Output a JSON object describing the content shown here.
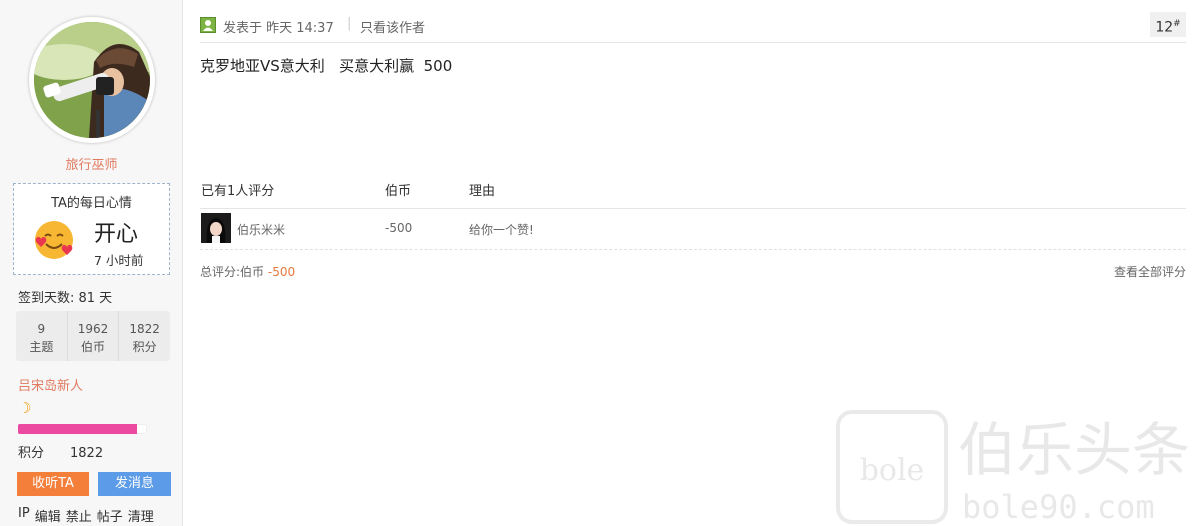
{
  "sidebar": {
    "username": "旅行巫师",
    "mood": {
      "title": "TA的每日心情",
      "state": "开心",
      "time": "7 小时前"
    },
    "checkin": "签到天数: 81 天",
    "stats": [
      {
        "value": "9",
        "label": "主题"
      },
      {
        "value": "1962",
        "label": "伯币"
      },
      {
        "value": "1822",
        "label": "积分"
      }
    ],
    "level": "吕宋岛新人",
    "level_progress": 0.92,
    "points_label": "积分",
    "points_value": "1822",
    "follow_button": "收听TA",
    "message_button": "发消息",
    "admin_links": [
      "IP",
      "编辑",
      "禁止",
      "帖子",
      "清理"
    ]
  },
  "post": {
    "posted_at": "发表于 昨天 14:37",
    "only_author": "只看该作者",
    "floor_number": "12",
    "floor_mark": "#",
    "content": "克罗地亚VS意大利   买意大利赢  500"
  },
  "rating": {
    "headers": {
      "count": "已有1人评分",
      "currency": "伯币",
      "reason": "理由"
    },
    "rows": [
      {
        "user": "伯乐米米",
        "value": "-500",
        "reason": "给你一个赞!"
      }
    ],
    "summary_label": "总评分:",
    "summary_currency": "伯币",
    "summary_value": "-500",
    "view_all": "查看全部评分"
  },
  "watermark": {
    "brand": "伯乐头条",
    "url": "bole90.com",
    "logo": "bole"
  },
  "colors": {
    "accent_orange": "#f37f3b",
    "accent_blue": "#5b9be7",
    "level_pink": "#ec4aa0",
    "username": "#e07a5f"
  }
}
